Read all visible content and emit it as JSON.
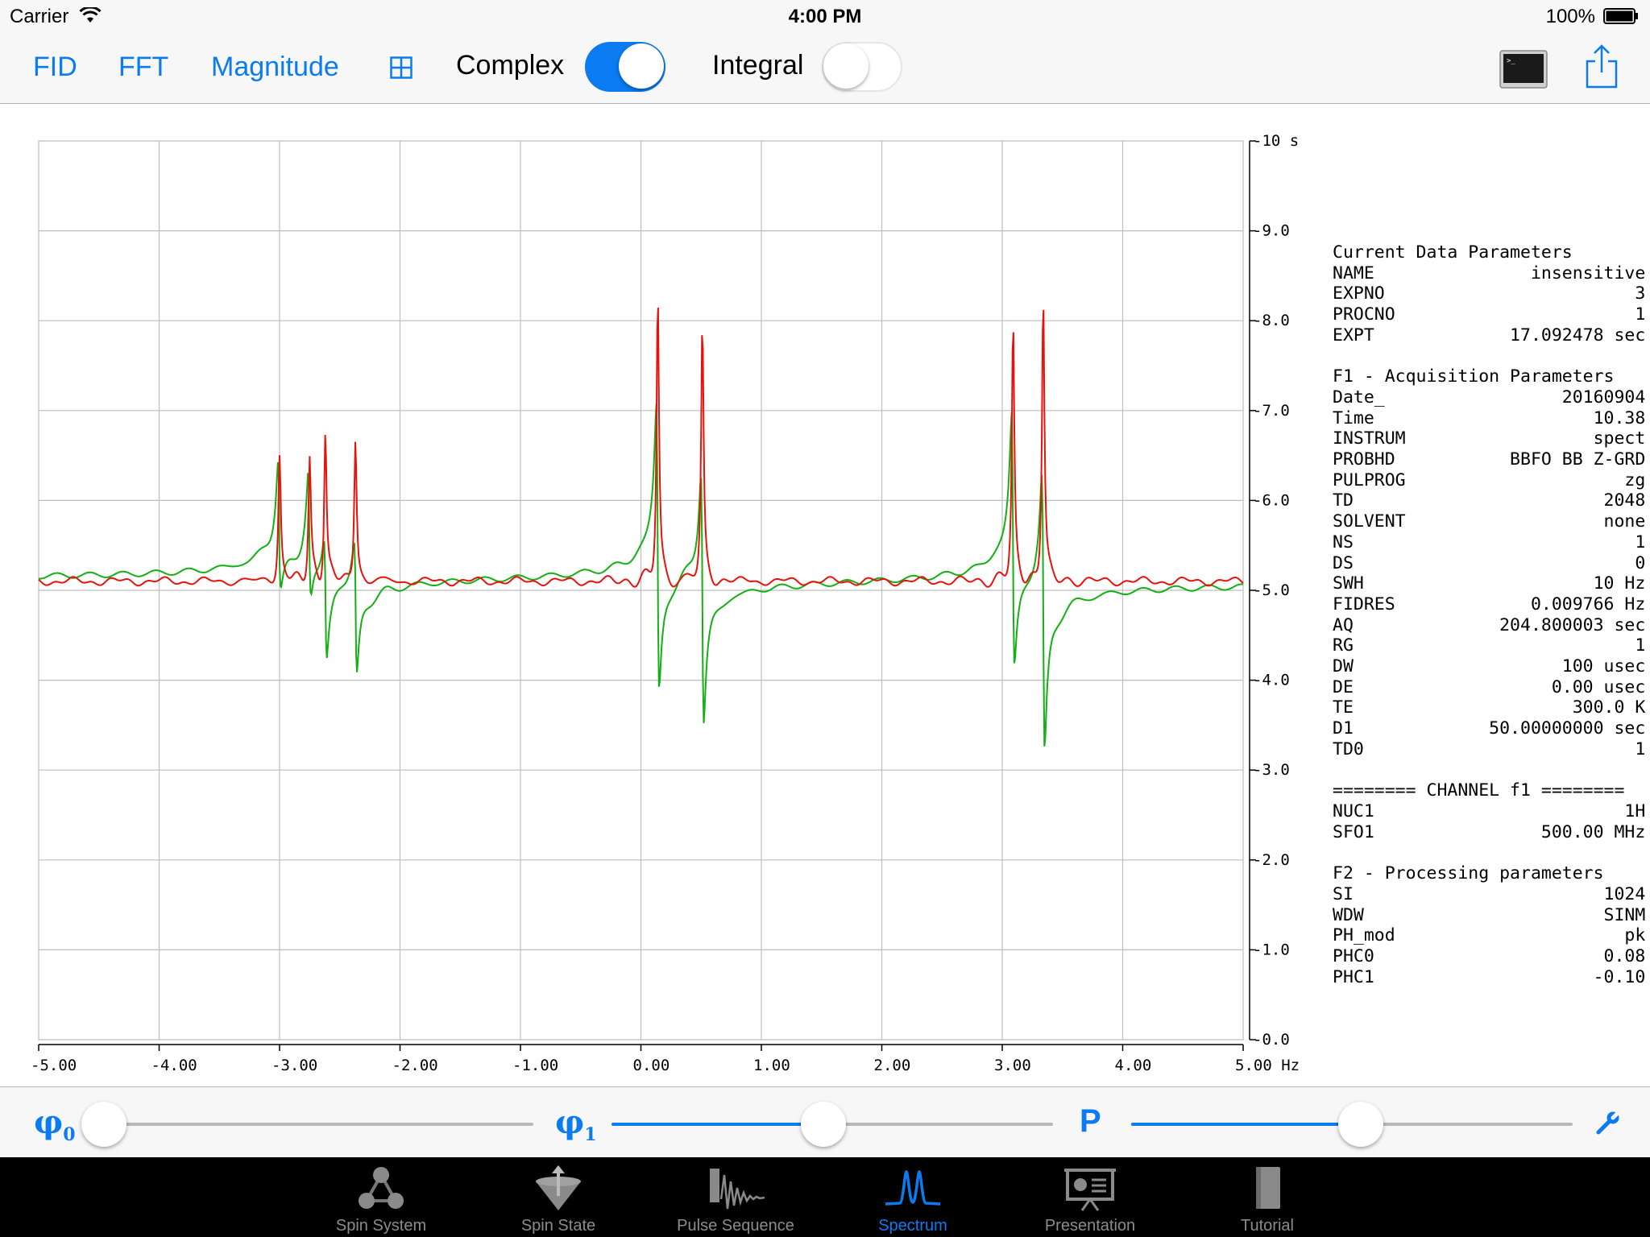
{
  "status_bar": {
    "carrier": "Carrier",
    "time": "4:00 PM",
    "battery": "100%"
  },
  "toolbar": {
    "fid": "FID",
    "fft": "FFT",
    "magnitude": "Magnitude",
    "complex_label": "Complex",
    "complex_on": true,
    "integral_label": "Integral",
    "integral_on": false
  },
  "chart_data": {
    "type": "line",
    "x_unit": "Hz",
    "y_unit": "s",
    "xlim": [
      -5.0,
      5.0
    ],
    "ylim": [
      0.0,
      10.0
    ],
    "x_ticks": [
      "-5.00",
      "-4.00",
      "-3.00",
      "-2.00",
      "-1.00",
      "0.00",
      "1.00",
      "2.00",
      "3.00",
      "4.00",
      "5.00 Hz"
    ],
    "y_ticks": [
      "-10 s",
      "-9.0",
      "-8.0",
      "-7.0",
      "-6.0",
      "-5.0",
      "-4.0",
      "-3.0",
      "-2.0",
      "-1.0",
      "-0.0"
    ],
    "grid": true,
    "baseline": 5.1,
    "series": [
      {
        "color": "#e8120c",
        "role": "real",
        "peaks": [
          {
            "x": -3.0,
            "h": 6.5
          },
          {
            "x": -2.75,
            "h": 6.45
          },
          {
            "x": -2.62,
            "h": 6.8
          },
          {
            "x": -2.37,
            "h": 6.7
          },
          {
            "x": 0.14,
            "h": 8.3
          },
          {
            "x": 0.51,
            "h": 7.95
          },
          {
            "x": 3.09,
            "h": 7.95
          },
          {
            "x": 3.34,
            "h": 8.3
          }
        ]
      },
      {
        "color": "#12b012",
        "role": "imaginary",
        "extrema": [
          {
            "x": -3.0,
            "max": 6.3,
            "min": 4.8
          },
          {
            "x": -2.75,
            "max": 6.2,
            "min": 4.75
          },
          {
            "x": -2.62,
            "max": 5.6,
            "min": 4.25
          },
          {
            "x": -2.37,
            "max": 5.6,
            "min": 4.1
          },
          {
            "x": 0.14,
            "max": 7.0,
            "min": 3.8
          },
          {
            "x": 0.51,
            "max": 6.4,
            "min": 3.6
          },
          {
            "x": 3.09,
            "max": 6.9,
            "min": 4.05
          },
          {
            "x": 3.34,
            "max": 6.4,
            "min": 3.3
          }
        ]
      }
    ]
  },
  "params": [
    [
      "Current Data Parameters",
      ""
    ],
    [
      "NAME",
      "insensitive"
    ],
    [
      "EXPNO",
      "3"
    ],
    [
      "PROCNO",
      "1"
    ],
    [
      "EXPT",
      "17.092478 sec"
    ],
    [
      "",
      ""
    ],
    [
      "F1 - Acquisition Parameters",
      ""
    ],
    [
      "Date_",
      "20160904"
    ],
    [
      "Time",
      "10.38"
    ],
    [
      "INSTRUM",
      "spect"
    ],
    [
      "PROBHD",
      "BBFO BB Z-GRD"
    ],
    [
      "PULPROG",
      "zg"
    ],
    [
      "TD",
      "2048"
    ],
    [
      "SOLVENT",
      "none"
    ],
    [
      "NS",
      "1"
    ],
    [
      "DS",
      "0"
    ],
    [
      "SWH",
      "10 Hz"
    ],
    [
      "FIDRES",
      "0.009766 Hz"
    ],
    [
      "AQ",
      "204.800003 sec"
    ],
    [
      "RG",
      "1"
    ],
    [
      "DW",
      "100 usec"
    ],
    [
      "DE",
      "0.00 usec"
    ],
    [
      "TE",
      "300.0 K"
    ],
    [
      "D1",
      "50.00000000 sec"
    ],
    [
      "TD0",
      "1"
    ],
    [
      "",
      ""
    ],
    [
      "======== CHANNEL f1 ========",
      ""
    ],
    [
      "NUC1",
      "1H"
    ],
    [
      "SFO1",
      "500.00 MHz"
    ],
    [
      "",
      ""
    ],
    [
      "F2 - Processing parameters",
      ""
    ],
    [
      "SI",
      "1024"
    ],
    [
      "WDW",
      "SINM"
    ],
    [
      "PH_mod",
      "pk"
    ],
    [
      "PHC0",
      "0.08"
    ],
    [
      "PHC1",
      "-0.10"
    ]
  ],
  "sliders": {
    "phi0": {
      "symbol": "φ",
      "sub": "0",
      "value": 0.03
    },
    "phi1": {
      "symbol": "φ",
      "sub": "1",
      "value": 0.48
    },
    "p": {
      "symbol": "P",
      "value": 0.52
    }
  },
  "tabs": [
    {
      "label": "Spin System",
      "icon": "spin-system-icon",
      "active": false
    },
    {
      "label": "Spin State",
      "icon": "spin-state-icon",
      "active": false
    },
    {
      "label": "Pulse Sequence",
      "icon": "pulse-sequence-icon",
      "active": false
    },
    {
      "label": "Spectrum",
      "icon": "spectrum-icon",
      "active": true
    },
    {
      "label": "Presentation",
      "icon": "presentation-icon",
      "active": false
    },
    {
      "label": "Tutorial",
      "icon": "tutorial-icon",
      "active": false
    }
  ]
}
